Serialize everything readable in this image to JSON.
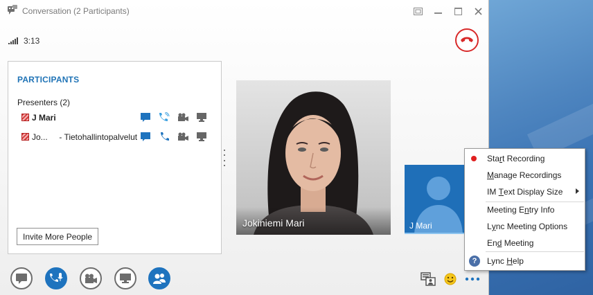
{
  "window": {
    "title": "Conversation (2 Participants)",
    "call_timer": "3:13"
  },
  "participants_panel": {
    "title": "PARTICIPANTS",
    "group_label": "Presenters (2)",
    "rows": [
      {
        "name": "J Mari",
        "bold": true
      },
      {
        "name": "Jo...     - Tietohallintopalvelut",
        "bold": false
      }
    ],
    "invite_button": "Invite More People"
  },
  "video": {
    "main_name": "Jokiniemi Mari",
    "self_name": "J Mari"
  },
  "toolbar": {
    "buttons": [
      "im-icon",
      "microphone-icon",
      "video-camera-icon",
      "present-screen-icon",
      "participants-icon"
    ]
  },
  "menu": {
    "items": [
      {
        "pre": "Sta",
        "u": "r",
        "post": "t Recording"
      },
      {
        "pre": "",
        "u": "M",
        "post": "anage Recordings"
      },
      {
        "pre": "IM ",
        "u": "T",
        "post": "ext Display Size"
      },
      {
        "pre": "Meeting E",
        "u": "n",
        "post": "try Info"
      },
      {
        "pre": "L",
        "u": "y",
        "post": "nc Meeting Options"
      },
      {
        "pre": "En",
        "u": "d",
        "post": " Meeting"
      },
      {
        "pre": "Lync ",
        "u": "H",
        "post": "elp"
      }
    ]
  },
  "colors": {
    "accent": "#1e73be",
    "hangup": "#d82929",
    "record_dot": "#e02020"
  }
}
